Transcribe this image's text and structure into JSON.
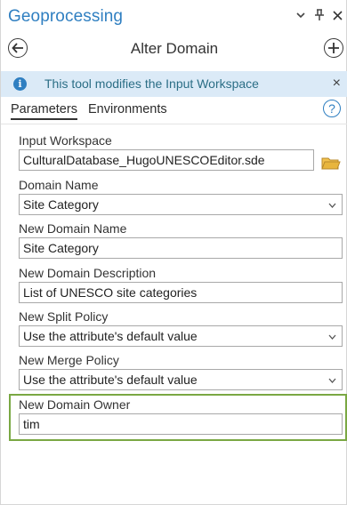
{
  "pane": {
    "title": "Geoprocessing",
    "controls": {
      "options": "▾",
      "pin": "‖",
      "close": "×"
    }
  },
  "tool": {
    "title": "Alter Domain"
  },
  "banner": {
    "icon": "info-icon",
    "text": "This tool modifies the Input Workspace",
    "close": "×"
  },
  "tabs": [
    {
      "label": "Parameters",
      "active": true
    },
    {
      "label": "Environments",
      "active": false
    }
  ],
  "help": {
    "glyph": "?"
  },
  "params": {
    "input_workspace": {
      "label": "Input Workspace",
      "value": "CulturalDatabase_HugoUNESCOEditor.sde"
    },
    "domain_name": {
      "label": "Domain Name",
      "value": "Site Category"
    },
    "new_domain_name": {
      "label": "New Domain Name",
      "value": "Site Category"
    },
    "new_domain_description": {
      "label": "New Domain Description",
      "value": "List of UNESCO site categories"
    },
    "new_split_policy": {
      "label": "New Split Policy",
      "value": "Use the attribute's default value"
    },
    "new_merge_policy": {
      "label": "New Merge Policy",
      "value": "Use the attribute's default value"
    },
    "new_domain_owner": {
      "label": "New Domain Owner",
      "value": "tim"
    }
  },
  "colors": {
    "title_blue": "#2f7fc1",
    "banner_bg": "#dbeaf7",
    "banner_text": "#2b6e86",
    "highlight_green": "#7aa843",
    "folder_yellow": "#e8b53d"
  }
}
